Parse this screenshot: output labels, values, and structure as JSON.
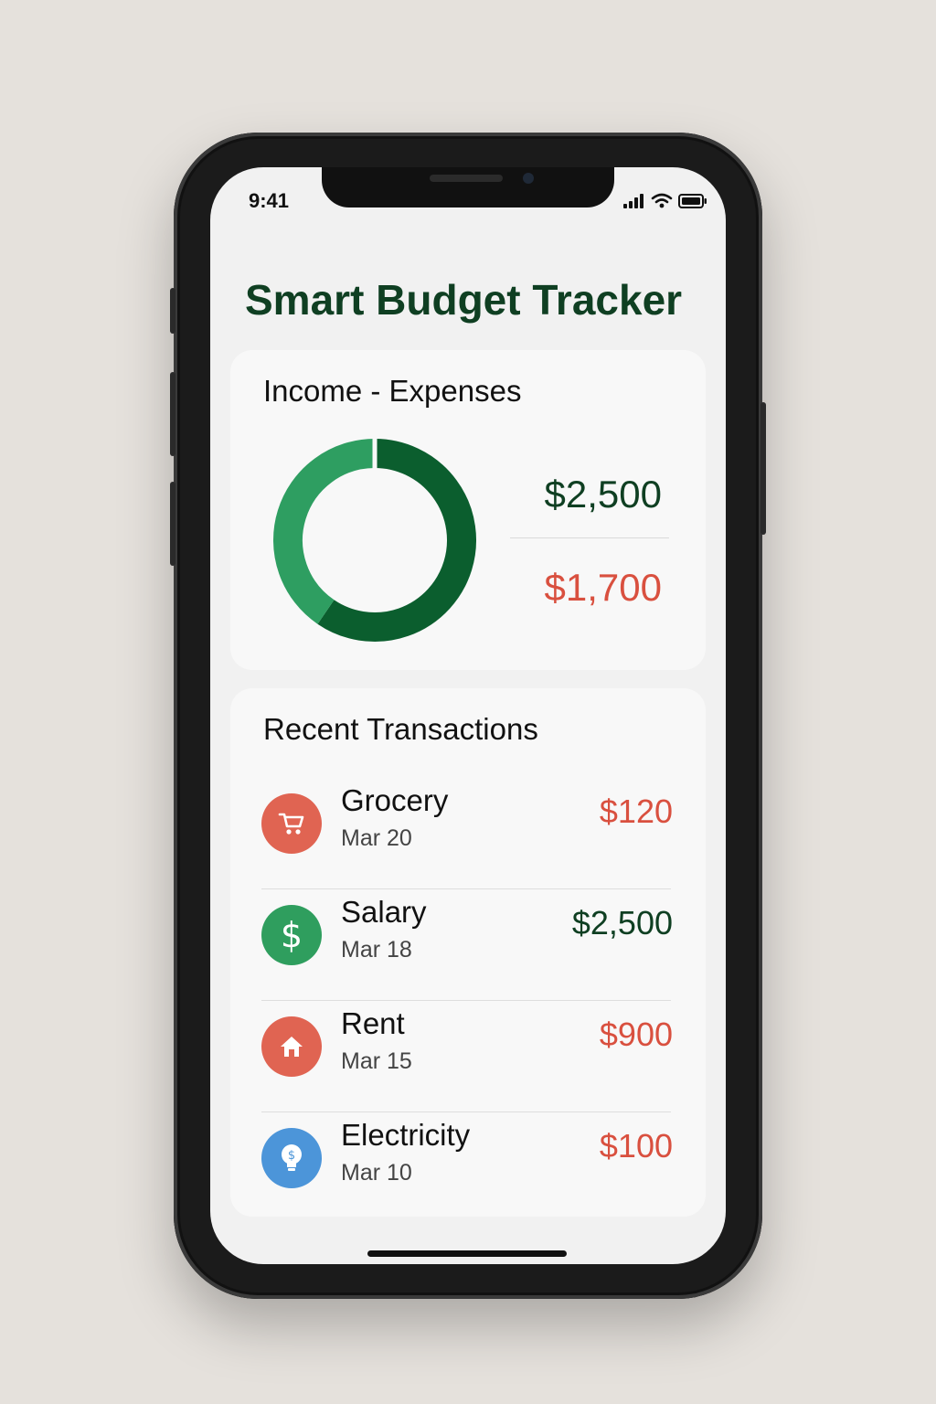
{
  "status_bar": {
    "time": "9:41",
    "icons": [
      "signal-icon",
      "wifi-icon",
      "battery-icon"
    ]
  },
  "app": {
    "title": "Smart Budget Tracker"
  },
  "summary": {
    "heading": "Income - Expenses",
    "income": "$2,500",
    "expenses": "$1,700",
    "donut": {
      "income_color": "#0b5e2e",
      "expense_color": "#2e9e61"
    }
  },
  "transactions": {
    "heading": "Recent Transactions",
    "items": [
      {
        "name": "Grocery",
        "date": "Mar 20",
        "amount": "$120",
        "type": "expense",
        "icon": "cart-icon",
        "icon_color": "#e06452"
      },
      {
        "name": "Salary",
        "date": "Mar 18",
        "amount": "$2,500",
        "type": "income",
        "icon": "dollar-icon",
        "icon_color": "#2f9e5e"
      },
      {
        "name": "Rent",
        "date": "Mar 15",
        "amount": "$900",
        "type": "expense",
        "icon": "house-icon",
        "icon_color": "#e06452"
      },
      {
        "name": "Electricity",
        "date": "Mar 10",
        "amount": "$100",
        "type": "expense",
        "icon": "lightbulb-icon",
        "icon_color": "#4c95d9"
      }
    ]
  },
  "colors": {
    "income_text": "#0f3f22",
    "expense_text": "#d9503f"
  }
}
